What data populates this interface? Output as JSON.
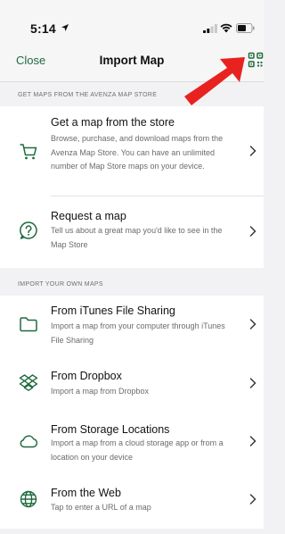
{
  "status_bar": {
    "time": "5:14"
  },
  "nav": {
    "close_label": "Close",
    "title": "Import Map"
  },
  "sections": [
    {
      "header": "GET MAPS FROM THE AVENZA MAP STORE",
      "rows": [
        {
          "title": "Get a map from the store",
          "desc": "Browse, purchase, and download maps from the Avenza Map Store. You can have an unlimited number of Map Store maps on your device.",
          "icon": "cart-icon"
        },
        {
          "title": "Request a map",
          "desc": "Tell us about a great map you'd like to see in the Map Store",
          "icon": "question-icon"
        }
      ]
    },
    {
      "header": "IMPORT YOUR OWN MAPS",
      "rows": [
        {
          "title": "From iTunes File Sharing",
          "desc": "Import a map from your computer through iTunes File Sharing",
          "icon": "folder-icon"
        },
        {
          "title": "From Dropbox",
          "desc": "Import a map from Dropbox",
          "icon": "dropbox-icon"
        },
        {
          "title": "From Storage Locations",
          "desc": "Import a map from a cloud storage app or from a location on your device",
          "icon": "cloud-icon"
        },
        {
          "title": "From the Web",
          "desc": "Tap to enter a URL of a map",
          "icon": "globe-icon"
        }
      ]
    }
  ],
  "colors": {
    "accent": "#1f6b3f",
    "annotation": "#e8231f"
  }
}
